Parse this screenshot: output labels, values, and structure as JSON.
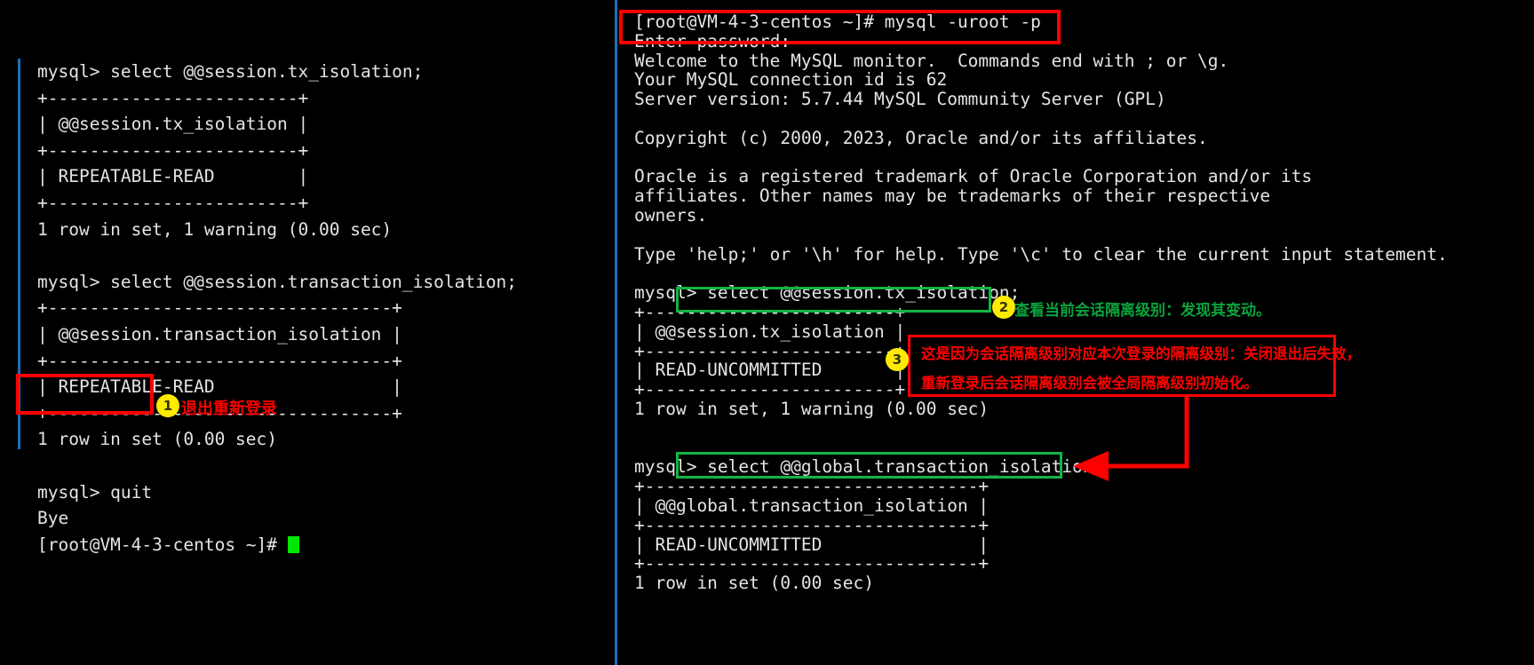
{
  "left_terminal": {
    "name": "left-terminal-session",
    "lines": [
      "mysql> select @@session.tx_isolation;",
      "+------------------------+",
      "| @@session.tx_isolation |",
      "+------------------------+",
      "| REPEATABLE-READ        |",
      "+------------------------+",
      "1 row in set, 1 warning (0.00 sec)",
      "",
      "mysql> select @@session.transaction_isolation;",
      "+---------------------------------+",
      "| @@session.transaction_isolation |",
      "+---------------------------------+",
      "| REPEATABLE-READ                 |",
      "+---------------------------------+",
      "1 row in set (0.00 sec)",
      "",
      "mysql> quit",
      "Bye",
      "[root@VM-4-3-centos ~]# "
    ]
  },
  "right_terminal": {
    "name": "right-terminal-session",
    "lines": [
      "[root@VM-4-3-centos ~]# mysql -uroot -p",
      "Enter password:",
      "Welcome to the MySQL monitor.  Commands end with ; or \\g.",
      "Your MySQL connection id is 62",
      "Server version: 5.7.44 MySQL Community Server (GPL)",
      "",
      "Copyright (c) 2000, 2023, Oracle and/or its affiliates.",
      "",
      "Oracle is a registered trademark of Oracle Corporation and/or its",
      "affiliates. Other names may be trademarks of their respective",
      "owners.",
      "",
      "Type 'help;' or '\\h' for help. Type '\\c' to clear the current input statement.",
      "",
      "mysql> select @@session.tx_isolation;",
      "+------------------------+",
      "| @@session.tx_isolation |",
      "+------------------------+",
      "| READ-UNCOMMITTED       |",
      "+------------------------+",
      "1 row in set, 1 warning (0.00 sec)",
      "",
      "",
      "mysql> select @@global.transaction_isolation;",
      "+--------------------------------+",
      "| @@global.transaction_isolation |",
      "+--------------------------------+",
      "| READ-UNCOMMITTED               |",
      "+--------------------------------+",
      "1 row in set (0.00 sec)"
    ]
  },
  "annotations": {
    "note1": {
      "number": "1",
      "text": "退出重新登录"
    },
    "note2": {
      "number": "2",
      "text": "查看当前会话隔离级别：发现其变动。"
    },
    "note3": {
      "number": "3",
      "line1": "这是因为会话隔离级别对应本次登录的隔离级别：关闭退出后失效，",
      "line2": "重新登录后会话隔离级别会被全局隔离级别初始化。"
    }
  },
  "colors": {
    "highlight_red": "#fe0000",
    "highlight_green": "#12b544",
    "badge_yellow": "#ffeb00",
    "terminal_text": "#e4e4e4",
    "pane_edge_blue": "#1e6fb8",
    "cursor_green": "#00e800"
  }
}
